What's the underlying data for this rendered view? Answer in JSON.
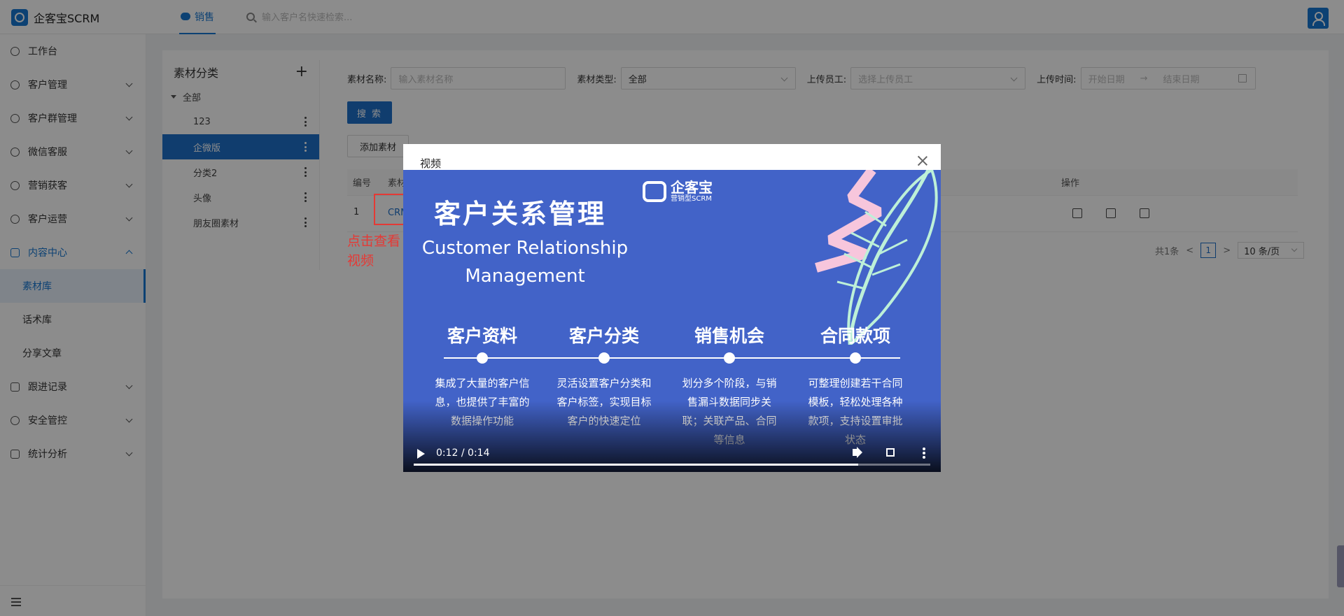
{
  "app": {
    "title": "企客宝SCRM"
  },
  "topnav": {
    "active_tab": "销售",
    "search_placeholder": "输入客户名快速检索..."
  },
  "sidebar": {
    "items": [
      {
        "label": "工作台"
      },
      {
        "label": "客户管理"
      },
      {
        "label": "客户群管理"
      },
      {
        "label": "微信客服"
      },
      {
        "label": "营销获客"
      },
      {
        "label": "客户运营"
      },
      {
        "label": "内容中心"
      },
      {
        "label": "素材库"
      },
      {
        "label": "话术库"
      },
      {
        "label": "分享文章"
      },
      {
        "label": "跟进记录"
      },
      {
        "label": "安全管控"
      },
      {
        "label": "统计分析"
      }
    ]
  },
  "category": {
    "title": "素材分类",
    "add": "+",
    "root": "全部",
    "items": [
      "123",
      "企微版",
      "分类2",
      "头像",
      "朋友圈素材"
    ]
  },
  "filters": {
    "name_label": "素材名称:",
    "name_placeholder": "输入素材名称",
    "type_label": "素材类型:",
    "type_value": "全部",
    "uploader_label": "上传员工:",
    "uploader_placeholder": "选择上传员工",
    "time_label": "上传时间:",
    "start_placeholder": "开始日期",
    "arrow": "→",
    "end_placeholder": "结束日期"
  },
  "buttons": {
    "search": "搜 索",
    "add": "添加素材"
  },
  "table": {
    "headers": {
      "id": "编号",
      "material": "素材",
      "actions": "操作"
    },
    "rows": [
      {
        "id": "1",
        "material": "CRM"
      }
    ]
  },
  "annotation": {
    "line1": "点击查看",
    "line2": "视频"
  },
  "pagination": {
    "total": "共1条",
    "prev": "<",
    "current": "1",
    "next": ">",
    "size": "10 条/页"
  },
  "modal": {
    "title": "视频",
    "video": {
      "title_cn": "客户关系管理",
      "title_en_1": "Customer Relationship",
      "title_en_2": "Management",
      "brand_name": "企客宝",
      "brand_sub": "营销型SCRM",
      "features": [
        {
          "title": "客户资料",
          "desc": "集成了大量的客户信息，也提供了丰富的数据操作功能"
        },
        {
          "title": "客户分类",
          "desc": "灵活设置客户分类和客户标签，实现目标客户的快速定位"
        },
        {
          "title": "销售机会",
          "desc": "划分多个阶段，与销售漏斗数据同步关联；关联产品、合同等信息"
        },
        {
          "title": "合同款项",
          "desc": "可整理创建若干合同模板，轻松处理各种款项，支持设置审批状态"
        }
      ],
      "time": "0:12 / 0:14",
      "progress": 0.86
    }
  }
}
